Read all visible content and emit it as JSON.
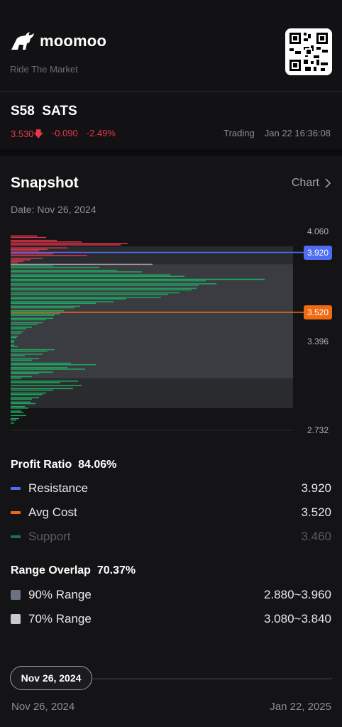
{
  "brand": {
    "name": "moomoo",
    "tagline": "Ride The Market"
  },
  "quote": {
    "symbol": "S58",
    "name": "SATS",
    "price": "3.530",
    "change": "-0.090",
    "change_pct": "-2.49%",
    "status": "Trading",
    "timestamp": "Jan 22 16:36:08"
  },
  "snapshot": {
    "title": "Snapshot",
    "chart_link": "Chart",
    "date": "Date: Nov 26, 2024"
  },
  "chart_data": {
    "type": "bar",
    "y_ticks": [
      "4.060",
      "3.396",
      "2.732"
    ],
    "ylim": [
      2.732,
      4.06
    ],
    "markers": [
      {
        "label": "3.920",
        "value": 3.92,
        "color": "#4f6cf2"
      },
      {
        "label": "3.520",
        "value": 3.52,
        "color": "#ef6a10"
      }
    ],
    "ranges": [
      {
        "name": "90% Range",
        "low": 2.88,
        "high": 3.96,
        "color": "#2a2b2f"
      },
      {
        "name": "70% Range",
        "low": 3.08,
        "high": 3.84,
        "color": "#3b3c42"
      }
    ],
    "bars_red_price_levels": [
      4.03,
      4.02,
      4.0,
      3.99,
      3.98,
      3.97,
      3.95,
      3.94,
      3.93,
      3.91,
      3.9,
      3.88,
      3.87,
      3.86,
      3.85
    ],
    "bars_red_values": [
      37,
      50,
      65,
      100,
      165,
      155,
      80,
      52,
      40,
      60,
      108,
      45,
      28,
      18,
      10
    ],
    "bars_green_price_levels": [
      3.83,
      3.82,
      3.8,
      3.79,
      3.77,
      3.76,
      3.74,
      3.73,
      3.71,
      3.7,
      3.68,
      3.67,
      3.65,
      3.64,
      3.62,
      3.61,
      3.59,
      3.58,
      3.56,
      3.55,
      3.53,
      3.51,
      3.5,
      3.48,
      3.47,
      3.45,
      3.44,
      3.42,
      3.41,
      3.39,
      3.38,
      3.36,
      3.35,
      3.33,
      3.32,
      3.3,
      3.29,
      3.27,
      3.26,
      3.24,
      3.23,
      3.21,
      3.2,
      3.18,
      3.17,
      3.15,
      3.14,
      3.12,
      3.11,
      3.09,
      3.08,
      3.06,
      3.05,
      3.03,
      3.01,
      3.0,
      2.98,
      2.97,
      2.95,
      2.94,
      2.92,
      2.91,
      2.89,
      2.88,
      2.86,
      2.85,
      2.83,
      2.81,
      2.8,
      2.78
    ],
    "bars_green_values": [
      60,
      125,
      150,
      185,
      225,
      245,
      358,
      275,
      290,
      265,
      262,
      255,
      238,
      222,
      212,
      163,
      145,
      120,
      98,
      90,
      75,
      70,
      62,
      60,
      50,
      45,
      38,
      30,
      22,
      18,
      15,
      10,
      8,
      5,
      5,
      5,
      10,
      62,
      52,
      45,
      20,
      40,
      30,
      85,
      120,
      80,
      105,
      60,
      40,
      30,
      15,
      95,
      70,
      100,
      88,
      60,
      50,
      45,
      40,
      30,
      28,
      35,
      20,
      25,
      15,
      18,
      22,
      12,
      8,
      5
    ],
    "bars_gray_price_levels": [
      3.84
    ],
    "bars_gray_values": [
      200
    ]
  },
  "profit": {
    "label": "Profit Ratio",
    "value": "84.06%",
    "items": [
      {
        "label": "Resistance",
        "value": "3.920",
        "color": "#4f6cf2"
      },
      {
        "label": "Avg Cost",
        "value": "3.520",
        "color": "#ef6a10"
      },
      {
        "label": "Support",
        "value": "3.460",
        "color": "#1b6b6b"
      }
    ]
  },
  "overlap": {
    "label": "Range Overlap",
    "value": "70.37%",
    "items": [
      {
        "label": "90% Range",
        "value": "2.880~3.960",
        "color": "#6b7380"
      },
      {
        "label": "70% Range",
        "value": "3.080~3.840",
        "color": "#c9c9cb"
      }
    ]
  },
  "timeline": {
    "selected": "Nov 26, 2024",
    "start": "Nov 26, 2024",
    "end": "Jan 22, 2025"
  }
}
